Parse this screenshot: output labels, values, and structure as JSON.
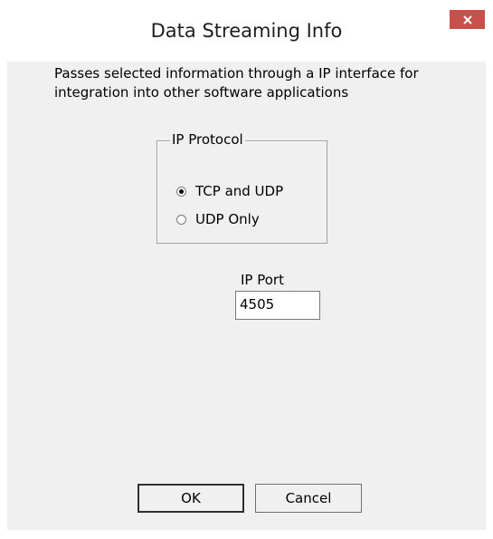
{
  "window": {
    "title": "Data Streaming Info",
    "close_icon": "close-icon"
  },
  "description": "Passes selected information through a IP interface for integration into other software applications",
  "ip_protocol": {
    "legend": "IP Protocol",
    "options": [
      {
        "label": "TCP and UDP",
        "selected": true
      },
      {
        "label": "UDP Only",
        "selected": false
      }
    ]
  },
  "ip_port": {
    "label": "IP Port",
    "value": "4505"
  },
  "buttons": {
    "ok": "OK",
    "cancel": "Cancel"
  },
  "colors": {
    "close_button": "#c7504a",
    "dialog_background": "#f0f0f0"
  }
}
